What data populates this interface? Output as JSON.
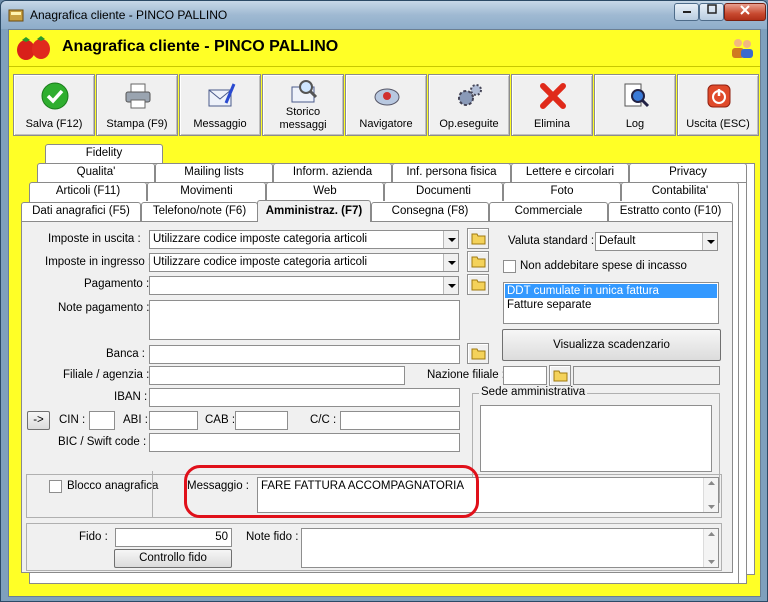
{
  "window": {
    "title": "Anagrafica cliente - PINCO PALLINO"
  },
  "header": {
    "title": "Anagrafica cliente - PINCO PALLINO"
  },
  "toolbar": [
    {
      "label": "Salva (F12)",
      "icon": "check-icon"
    },
    {
      "label": "Stampa (F9)",
      "icon": "printer-icon"
    },
    {
      "label": "Messaggio",
      "icon": "envelope-pen-icon"
    },
    {
      "label": "Storico messaggi",
      "icon": "envelope-search-icon"
    },
    {
      "label": "Navigatore",
      "icon": "navigator-icon"
    },
    {
      "label": "Op.eseguite",
      "icon": "gears-icon"
    },
    {
      "label": "Elimina",
      "icon": "delete-x-icon"
    },
    {
      "label": "Log",
      "icon": "log-search-icon"
    },
    {
      "label": "Uscita (ESC)",
      "icon": "power-icon"
    }
  ],
  "tabs": {
    "row1": [
      "Fidelity"
    ],
    "row2": [
      "Qualita'",
      "Mailing lists",
      "Inform. azienda",
      "Inf. persona fisica",
      "Lettere e circolari",
      "Privacy"
    ],
    "row3": [
      "Articoli (F11)",
      "Movimenti",
      "Web",
      "Documenti",
      "Foto",
      "Contabilita'"
    ],
    "row4": [
      "Dati anagrafici (F5)",
      "Telefono/note (F6)",
      "Amministraz. (F7)",
      "Consegna (F8)",
      "Commerciale",
      "Estratto conto (F10)"
    ],
    "active": "Amministraz. (F7)"
  },
  "form": {
    "imposte_uscita_label": "Imposte in uscita :",
    "imposte_uscita_value": "Utilizzare codice imposte categoria articoli",
    "imposte_ingresso_label": "Imposte in ingresso :",
    "imposte_ingresso_value": "Utilizzare codice imposte categoria articoli",
    "pagamento_label": "Pagamento :",
    "pagamento_value": "",
    "note_pagamento_label": "Note pagamento :",
    "banca_label": "Banca :",
    "filiale_label": "Filiale / agenzia :",
    "nazione_filiale_label": "Nazione filiale :",
    "iban_label": "IBAN :",
    "arrow_button": "->",
    "cin_label": "CIN :",
    "abi_label": "ABI :",
    "cab_label": "CAB :",
    "cc_label": "C/C :",
    "bic_label": "BIC / Swift code :",
    "valuta_label": "Valuta standard :",
    "valuta_value": "Default",
    "non_addebitare_label": "Non addebitare spese di incasso",
    "ddt_options": [
      "DDT cumulate in unica fattura",
      "Fatture separate"
    ],
    "visualizza_button": "Visualizza scadenzario",
    "sede_label": "Sede amministrativa",
    "blocco_label": "Blocco anagrafica",
    "messaggio_label": "Messaggio :",
    "messaggio_value": "FARE FATTURA ACCOMPAGNATORIA",
    "fido_label": "Fido :",
    "fido_value": "50",
    "note_fido_label": "Note fido :",
    "controllo_button": "Controllo fido"
  },
  "colors": {
    "header_yellow": "#ffff26",
    "highlight": "#e0101a",
    "selection": "#3399ff"
  }
}
